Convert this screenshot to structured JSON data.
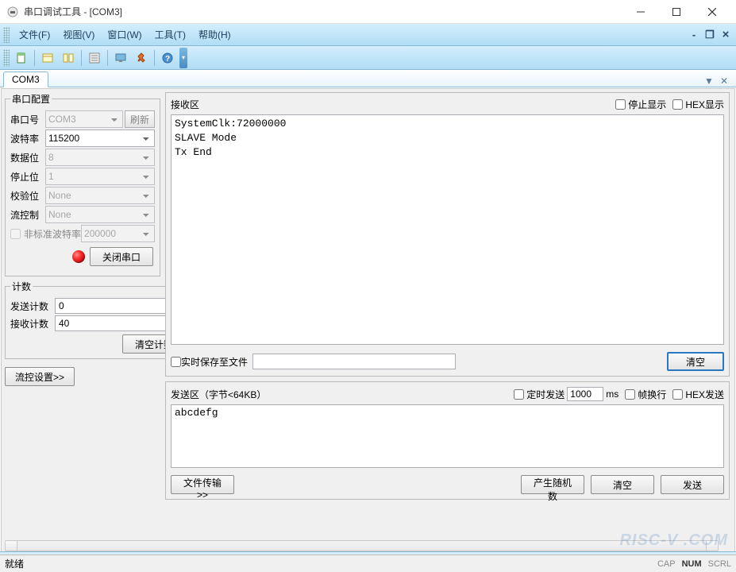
{
  "window": {
    "title": "串口调试工具 - [COM3]"
  },
  "menu": {
    "file": "文件(F)",
    "view": "视图(V)",
    "window": "窗口(W)",
    "tools": "工具(T)",
    "help": "帮助(H)"
  },
  "icons": {
    "new": "new",
    "open": "open",
    "tile": "tile",
    "props": "props",
    "monitor": "monitor",
    "pin": "pin",
    "help": "help"
  },
  "tab": {
    "label": "COM3"
  },
  "config": {
    "legend": "串口配置",
    "port_label": "串口号",
    "port": "COM3",
    "refresh": "刷新",
    "baud_label": "波特率",
    "baud": "115200",
    "databits_label": "数据位",
    "databits": "8",
    "stopbits_label": "停止位",
    "stopbits": "1",
    "parity_label": "校验位",
    "parity": "None",
    "flow_label": "流控制",
    "flow": "None",
    "nonstd_label": "非标准波特率",
    "nonstd_value": "200000",
    "close_port": "关闭串口"
  },
  "counter": {
    "legend": "计数",
    "send_label": "发送计数",
    "send_value": "0",
    "recv_label": "接收计数",
    "recv_value": "40",
    "clear": "清空计数"
  },
  "flow_settings": "流控设置>>",
  "rx": {
    "title": "接收区",
    "stop_display": "停止显示",
    "hex_display": "HEX显示",
    "text": "SystemClk:72000000\nSLAVE Mode\nTx End",
    "save_to_file": "实时保存至文件",
    "save_path": "",
    "clear": "清空"
  },
  "tx": {
    "title": "发送区（字节<64KB）",
    "timed_send": "定时发送",
    "interval": "1000",
    "ms": "ms",
    "wrap": "帧换行",
    "hex_send": "HEX发送",
    "text": "abcdefg",
    "file_transfer": "文件传输>>",
    "gen_random": "产生随机数",
    "clear": "清空",
    "send": "发送"
  },
  "status": {
    "ready": "就绪",
    "cap": "CAP",
    "num": "NUM",
    "scrl": "SCRL"
  },
  "watermark": "RISC-V .COM"
}
